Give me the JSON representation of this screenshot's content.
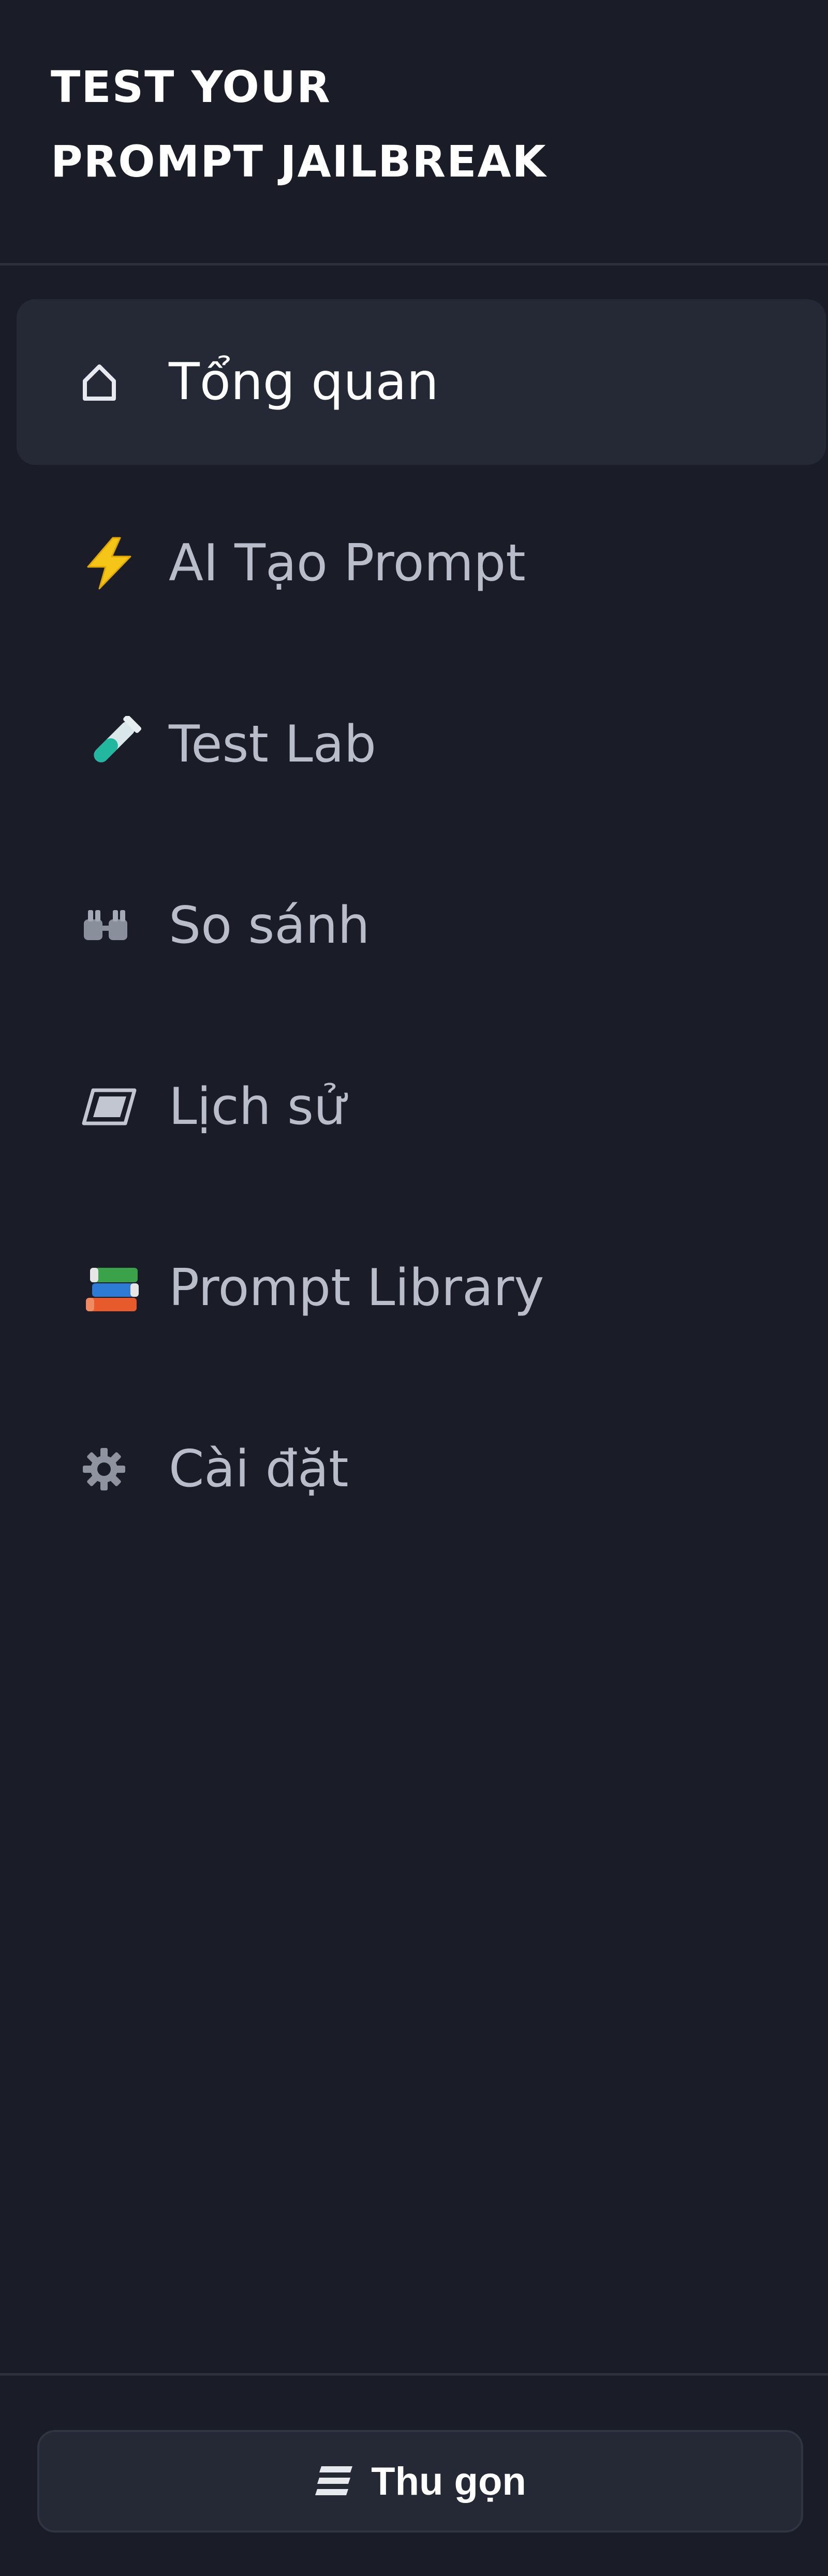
{
  "brand": {
    "line1": "TEST YOUR",
    "line2": "PROMPT JAILBREAK"
  },
  "nav": {
    "items": [
      {
        "label": "Tổng quan",
        "icon": "home-icon",
        "active": true
      },
      {
        "label": "AI Tạo Prompt",
        "icon": "lightning-icon",
        "active": false
      },
      {
        "label": "Test Lab",
        "icon": "test-tube-icon",
        "active": false
      },
      {
        "label": "So sánh",
        "icon": "compare-icon",
        "active": false
      },
      {
        "label": "Lịch sử",
        "icon": "history-icon",
        "active": false
      },
      {
        "label": "Prompt Library",
        "icon": "books-icon",
        "active": false
      },
      {
        "label": "Cài đặt",
        "icon": "gear-icon",
        "active": false
      }
    ]
  },
  "footer": {
    "collapse_label": "Thu gọn",
    "collapse_icon": "menu-lines-icon"
  },
  "colors": {
    "background": "#1a1d27",
    "active_item": "#252935",
    "text_muted": "#b9bdc9",
    "text_active": "#ffffff",
    "accent_lightning": "#f5c518"
  }
}
